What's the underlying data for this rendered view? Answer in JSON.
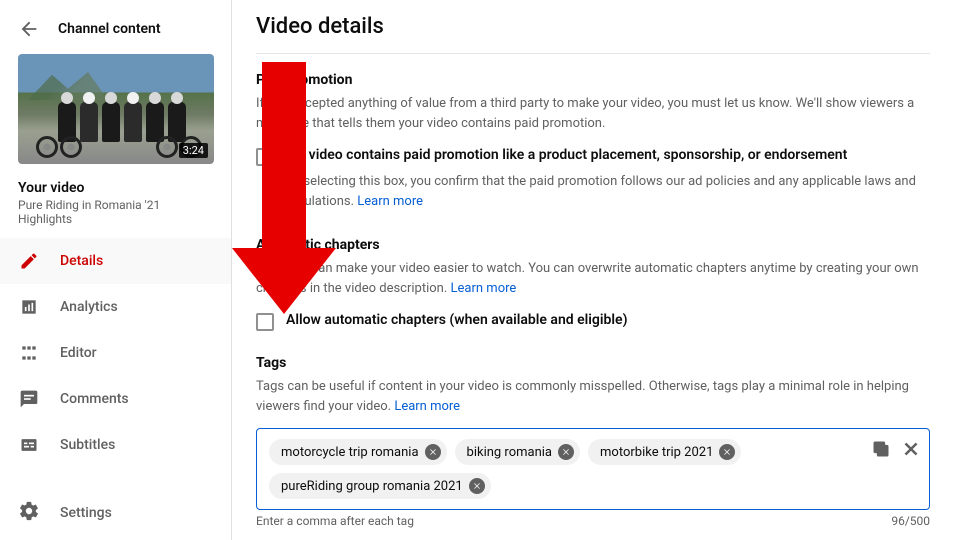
{
  "sidebar": {
    "back_label": "Channel content",
    "thumb_duration": "3:24",
    "your_video_label": "Your video",
    "video_title": "Pure Riding in Romania '21 Highlights",
    "items": [
      {
        "icon": "pencil-icon",
        "label": "Details",
        "active": true
      },
      {
        "icon": "analytics-icon",
        "label": "Analytics",
        "active": false
      },
      {
        "icon": "editor-icon",
        "label": "Editor",
        "active": false
      },
      {
        "icon": "comments-icon",
        "label": "Comments",
        "active": false
      },
      {
        "icon": "subtitles-icon",
        "label": "Subtitles",
        "active": false
      }
    ],
    "settings_label": "Settings"
  },
  "main": {
    "page_title": "Video details",
    "paid_promotion": {
      "heading": "Paid promotion",
      "description": "If you accepted anything of value from a third party to make your video, you must let us know. We'll show viewers a message that tells them your video contains paid promotion.",
      "checkbox_label": "My video contains paid promotion like a product placement, sponsorship, or endorsement",
      "confirm_text": "By selecting this box, you confirm that the paid promotion follows our ad policies and any applicable laws and regulations. ",
      "learn_more": "Learn more"
    },
    "auto_chapters": {
      "heading": "Automatic chapters",
      "description": "Chapters can make your video easier to watch. You can overwrite automatic chapters anytime by creating your own chapters in the video description. ",
      "learn_more": "Learn more",
      "checkbox_label": "Allow automatic chapters (when available and eligible)"
    },
    "tags": {
      "heading": "Tags",
      "description": "Tags can be useful if content in your video is commonly misspelled. Otherwise, tags play a minimal role in helping viewers find your video. ",
      "learn_more": "Learn more",
      "items": [
        "motorcycle trip romania",
        "biking romania",
        "motorbike trip 2021",
        "pureRiding group romania 2021"
      ],
      "hint": "Enter a comma after each tag",
      "counter": "96/500"
    }
  },
  "annotation": {
    "type": "arrow",
    "color": "#e60000",
    "points_to": "tags-section"
  }
}
